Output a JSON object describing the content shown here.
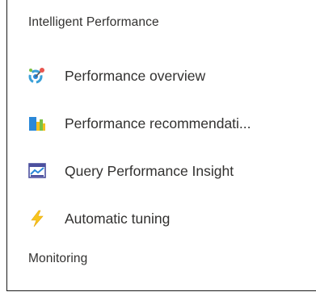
{
  "sections": [
    {
      "title": "Intelligent Performance",
      "items": [
        {
          "label": "Performance overview",
          "icon": "performance-overview-icon"
        },
        {
          "label": "Performance recommendati...",
          "icon": "performance-recommendations-icon"
        },
        {
          "label": "Query Performance Insight",
          "icon": "query-performance-insight-icon"
        },
        {
          "label": "Automatic tuning",
          "icon": "lightning-bolt-icon"
        }
      ]
    },
    {
      "title": "Monitoring",
      "items": []
    }
  ],
  "colors": {
    "text": "#323130",
    "frame_border": "#1b1b1b",
    "bolt": "#f7c51d",
    "folder_blue": "#2b88d8",
    "bar_yellow": "#f4bf1e",
    "bar_green": "#7ac143"
  }
}
